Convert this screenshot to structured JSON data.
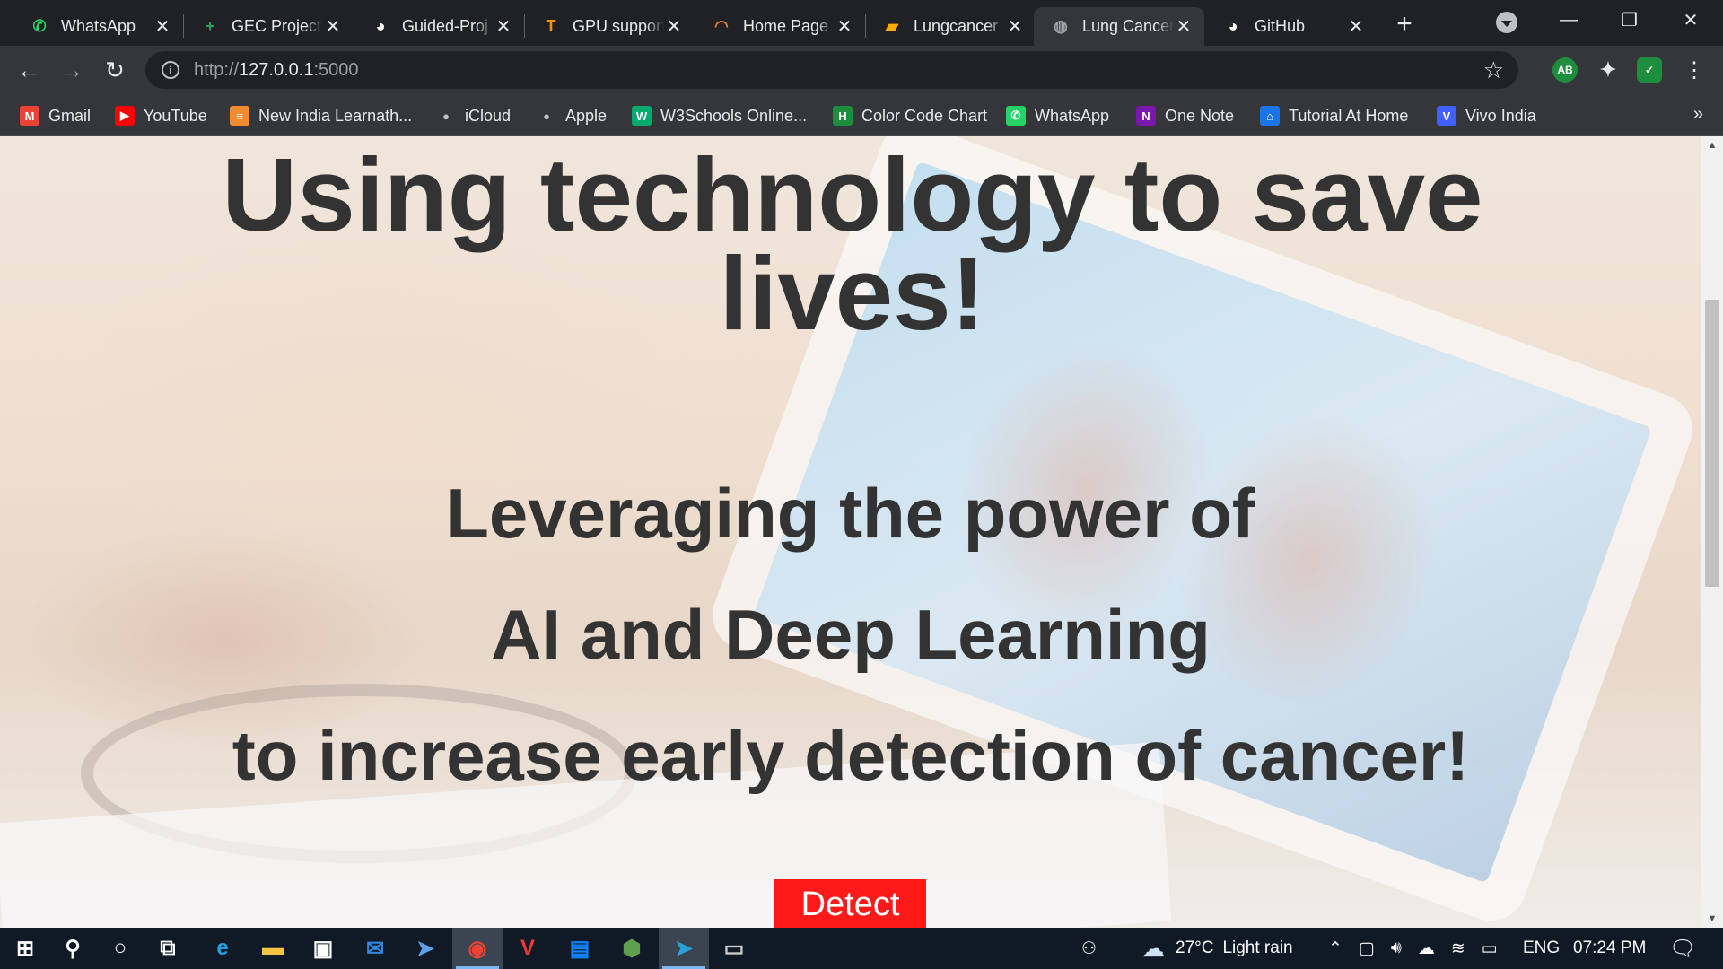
{
  "browser": {
    "tabs": [
      {
        "title": "WhatsApp",
        "icon": "whatsapp-icon",
        "color": "#25d366",
        "active": false
      },
      {
        "title": "GEC Project",
        "icon": "sheets-plus-icon",
        "color": "#1fa463",
        "active": false
      },
      {
        "title": "Guided-Proj",
        "icon": "github-icon",
        "color": "#ffffff",
        "active": false
      },
      {
        "title": "GPU support",
        "icon": "tensorflow-icon",
        "color": "#ff8f00",
        "active": false
      },
      {
        "title": "Home Page",
        "icon": "jupyter-icon",
        "color": "#f37726",
        "active": false
      },
      {
        "title": "Lungcancer",
        "icon": "notebook-icon",
        "color": "#f9ab00",
        "active": false
      },
      {
        "title": "Lung Cancer",
        "icon": "globe-icon",
        "color": "#9aa0a6",
        "active": true
      },
      {
        "title": "GitHub",
        "icon": "github-icon",
        "color": "#ffffff",
        "active": false
      }
    ],
    "new_tab_symbol": "+",
    "window_controls": {
      "minimize": "—",
      "restore": "❐",
      "close": "✕"
    },
    "url": {
      "scheme": "http://",
      "host": "127.0.0.1",
      "port": ":5000"
    },
    "extensions": [
      {
        "name": "adblock-icon",
        "label": "AB",
        "color": "#1e8e3e"
      },
      {
        "name": "extensions-puzzle-icon",
        "label": "✦",
        "color": "#e8eaed"
      },
      {
        "name": "shield-check-icon",
        "label": "✓",
        "color": "#1e8e3e"
      }
    ],
    "bookmarks": [
      {
        "label": "Gmail",
        "icon": "gmail-icon",
        "glyph": "M",
        "color": "#ea4335"
      },
      {
        "label": "YouTube",
        "icon": "youtube-icon",
        "glyph": "▶",
        "color": "#ff0000"
      },
      {
        "label": "New India Learnath...",
        "icon": "learnathon-icon",
        "glyph": "≡",
        "color": "#f28b30"
      },
      {
        "label": "iCloud",
        "icon": "apple-icon",
        "glyph": "",
        "color": "#5f6368"
      },
      {
        "label": "Apple",
        "icon": "apple-icon",
        "glyph": "",
        "color": "#5f6368"
      },
      {
        "label": "W3Schools Online...",
        "icon": "w3schools-icon",
        "glyph": "W",
        "color": "#04aa6d"
      },
      {
        "label": "Color Code Chart",
        "icon": "h-icon",
        "glyph": "H",
        "color": "#1e8e3e"
      },
      {
        "label": "WhatsApp",
        "icon": "whatsapp-icon",
        "glyph": "✆",
        "color": "#25d366"
      },
      {
        "label": "One Note",
        "icon": "onenote-icon",
        "glyph": "N",
        "color": "#7719aa"
      },
      {
        "label": "Tutorial At Home",
        "icon": "house-icon",
        "glyph": "⌂",
        "color": "#1a73e8"
      },
      {
        "label": "Vivo India",
        "icon": "vivo-icon",
        "glyph": "V",
        "color": "#415fff"
      }
    ],
    "bookmarks_overflow": "»"
  },
  "page": {
    "headline": "Using technology to save lives!",
    "line1": "Leveraging the power of",
    "line2": "AI and Deep Learning",
    "line3": "to increase early detection of cancer!",
    "detect_label": "Detect",
    "detect_color": "#ff1a1a"
  },
  "taskbar": {
    "apps": [
      {
        "name": "start-button",
        "glyph": "⊞",
        "color": "#ffffff"
      },
      {
        "name": "search-icon",
        "glyph": "⚲",
        "color": "#ffffff"
      },
      {
        "name": "cortana-icon",
        "glyph": "○",
        "color": "#ffffff"
      },
      {
        "name": "task-view-icon",
        "glyph": "⧉",
        "color": "#ffffff"
      },
      {
        "name": "edge-icon",
        "glyph": "e",
        "color": "#1fa0e0"
      },
      {
        "name": "file-explorer-icon",
        "glyph": "▬",
        "color": "#f6c443"
      },
      {
        "name": "store-icon",
        "glyph": "▣",
        "color": "#ffffff"
      },
      {
        "name": "mail-icon",
        "glyph": "✉",
        "color": "#2e86de"
      },
      {
        "name": "powershell-icon",
        "glyph": "➤",
        "color": "#5aa0e6"
      },
      {
        "name": "chrome-icon",
        "glyph": "◉",
        "color": "#ea4335",
        "active": true
      },
      {
        "name": "vivaldi-icon",
        "glyph": "V",
        "color": "#ef3939"
      },
      {
        "name": "cmd-icon",
        "glyph": "▤",
        "color": "#0a84ff"
      },
      {
        "name": "nodejs-icon",
        "glyph": "⬢",
        "color": "#5fa04e"
      },
      {
        "name": "telegram-icon",
        "glyph": "➤",
        "color": "#2aa1da",
        "active": true
      },
      {
        "name": "terminal-icon",
        "glyph": "▭",
        "color": "#d0d0d0"
      }
    ],
    "weather": {
      "temp": "27°C",
      "condition": "Light rain"
    },
    "language": "ENG",
    "time": "07:24 PM"
  }
}
